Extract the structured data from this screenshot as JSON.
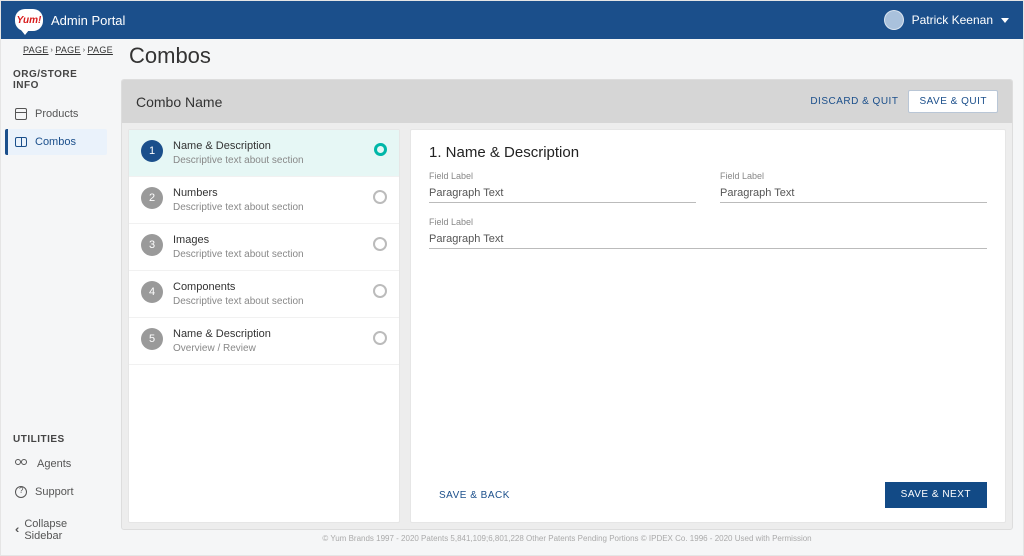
{
  "header": {
    "brand_text": "Yum!",
    "title": "Admin Portal",
    "user_name": "Patrick Keenan"
  },
  "breadcrumb": [
    "PAGE",
    "PAGE",
    "PAGE"
  ],
  "sidebar": {
    "section1_label": "ORG/STORE INFO",
    "items": [
      {
        "label": "Products"
      },
      {
        "label": "Combos"
      }
    ],
    "section2_label": "UTILITIES",
    "utilities": [
      {
        "label": "Agents"
      },
      {
        "label": "Support"
      }
    ],
    "collapse_label": "Collapse Sidebar"
  },
  "page": {
    "title": "Combos",
    "panel_title": "Combo Name",
    "discard_label": "DISCARD & QUIT",
    "save_quit_label": "SAVE & QUIT",
    "save_back_label": "SAVE & BACK",
    "save_next_label": "SAVE & NEXT"
  },
  "steps": [
    {
      "num": "1",
      "title": "Name & Description",
      "desc": "Descriptive text about section",
      "active": true
    },
    {
      "num": "2",
      "title": "Numbers",
      "desc": "Descriptive text about section"
    },
    {
      "num": "3",
      "title": "Images",
      "desc": "Descriptive text about section"
    },
    {
      "num": "4",
      "title": "Components",
      "desc": "Descriptive text about section"
    },
    {
      "num": "5",
      "title": "Name & Description",
      "desc": "Overview / Review"
    }
  ],
  "form": {
    "heading": "1. Name & Description",
    "fields": [
      {
        "label": "Field Label",
        "value": "Paragraph Text",
        "width": "half"
      },
      {
        "label": "Field Label",
        "value": "Paragraph Text",
        "width": "half"
      },
      {
        "label": "Field Label",
        "value": "Paragraph Text",
        "width": "full"
      }
    ]
  },
  "footer": {
    "text": "© Yum Brands 1997 - 2020 Patents 5,841,109;6,801,228 Other Patents Pending Portions © IPDEX Co. 1996 - 2020 Used with Permission"
  }
}
